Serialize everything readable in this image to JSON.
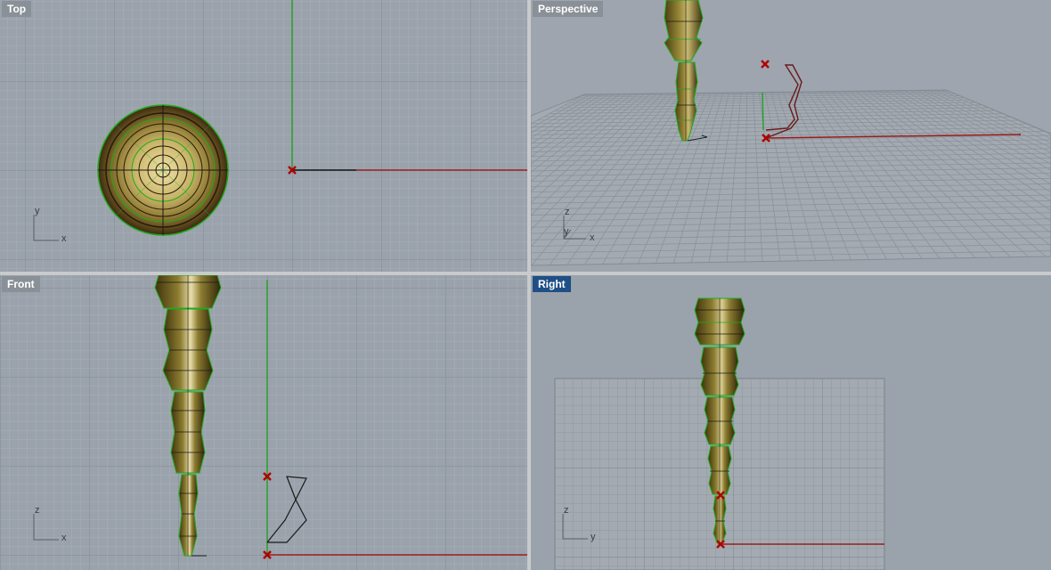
{
  "viewports": {
    "top": {
      "label": "Top",
      "active": false
    },
    "perspective": {
      "label": "Perspective",
      "active": false
    },
    "front": {
      "label": "Front",
      "active": false
    },
    "right": {
      "label": "Right",
      "active": true
    }
  },
  "axis_labels": {
    "top": {
      "a": "y",
      "b": "x"
    },
    "perspective": {
      "z": "z",
      "y": "y",
      "x": "x"
    },
    "front": {
      "a": "z",
      "b": "x"
    },
    "right": {
      "a": "z",
      "b": "y"
    }
  },
  "colors": {
    "viewport_bg": "#9aa2ab",
    "grid_minor": "#a9b0b8",
    "grid_major": "#7f878f",
    "x_axis": "#9b1c1c",
    "y_axis": "#2aa02a",
    "object_body": "#7a6a1e",
    "object_edge": "#1faa1f",
    "point_marker": "#b00000",
    "active_label": "#1f4f86"
  }
}
